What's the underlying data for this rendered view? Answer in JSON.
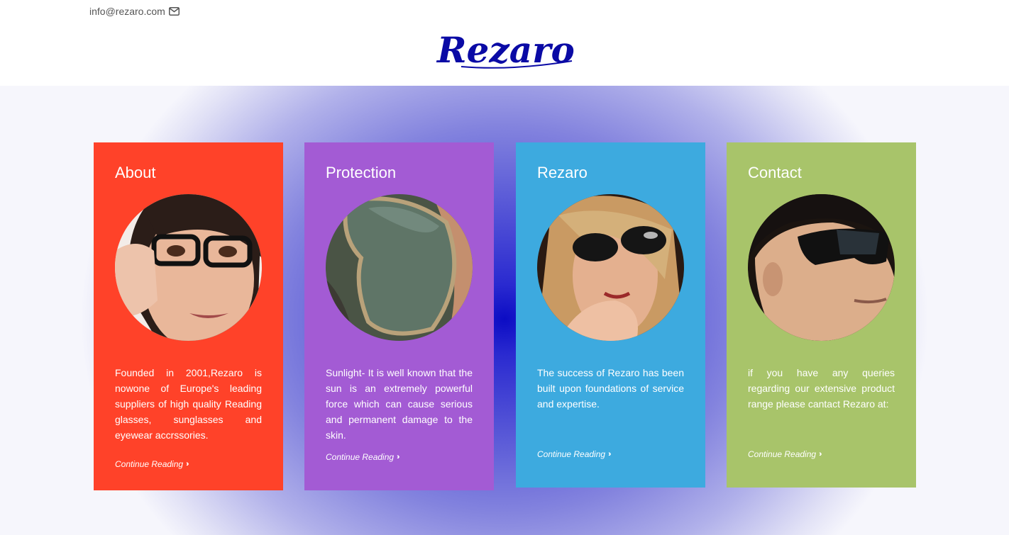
{
  "header": {
    "email": "info@rezaro.com",
    "email_icon": "envelope-icon",
    "logo_text": "Rezaro",
    "logo_color": "#0a0aa5"
  },
  "colors": {
    "about": "#ff4229",
    "protection": "#a35bd4",
    "rezaro": "#3daadf",
    "contact": "#a8c46a",
    "hero_center": "#0c0cc4"
  },
  "cards": [
    {
      "title": "About",
      "text": "Founded in 2001,Rezaro is nowone of Europe's leading suppliers of high quality Reading glasses, sunglasses and eyewear accrssories.",
      "link": "Continue Reading",
      "image": "woman-with-reading-glasses"
    },
    {
      "title": "Protection",
      "text": "Sunlight- It is well known that the sun is an extremely powerful force which can cause serious and permanent damage to the skin.",
      "link": "Continue Reading",
      "image": "aviator-sunglasses-lens"
    },
    {
      "title": "Rezaro",
      "text": "The success of Rezaro has been built upon foundations of service and expertise.",
      "link": "Continue Reading",
      "image": "woman-with-sunglasses"
    },
    {
      "title": "Contact",
      "text": "if you have any queries regarding our extensive product range please cantact Rezaro at:",
      "link": "Continue Reading",
      "image": "man-with-sunglasses"
    }
  ],
  "icons": {
    "continue": "double-chevron-right-icon"
  }
}
